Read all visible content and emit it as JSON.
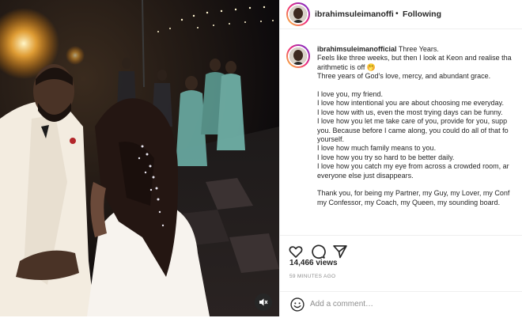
{
  "post": {
    "username": "ibrahimsuleimanofficial",
    "header_username": "ibrahimsuleimanofficia",
    "dot": "•",
    "follow_status": "Following",
    "caption_first": "Three Years.",
    "caption_lines": [
      "Feels like three weeks, but then I look at Keon and realise tha",
      "arithmetic is off 🤭",
      "Three years of God's love, mercy, and abundant grace.",
      "",
      "I love you, my friend.",
      "I love how intentional you are about choosing me everyday.",
      "I love how with us, even the most trying days can be funny.",
      "I love how you let me take care of you, provide for you, supp",
      "you. Because before I came along, you could do all of that fo",
      "yourself.",
      "I love how much family means to you.",
      "I love how you try so hard to be better daily.",
      "I love how you catch my eye from across a crowded room, ar",
      "everyone else just disappears.",
      "",
      "Thank you, for being my Partner, my Guy, my Lover, my Conf",
      "my Confessor, my Coach, my Queen, my sounding board."
    ],
    "views": "14,466 views",
    "timestamp": "59 MINUTES AGO",
    "comment_placeholder": "Add a comment…"
  },
  "icons": {
    "like": "heart-icon",
    "comment": "comment-bubble-icon",
    "share": "send-icon",
    "emoji": "smiley-icon",
    "mute": "speaker-muted-icon"
  },
  "colors": {
    "text": "#262626",
    "muted": "#8e8e8e",
    "border": "#efefef",
    "video_bg": "#0a0806",
    "gown": "#6fb6ad"
  }
}
